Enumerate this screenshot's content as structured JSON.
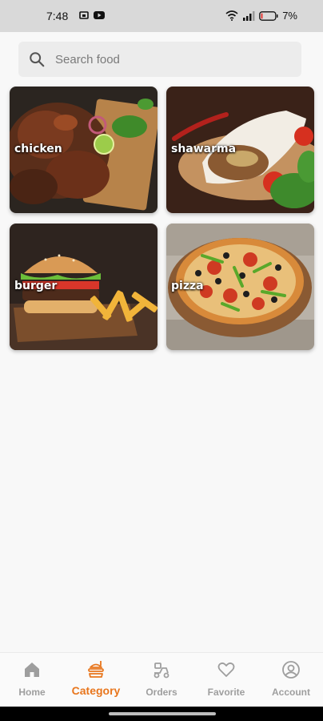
{
  "status_bar": {
    "time": "7:48",
    "battery": "7%"
  },
  "search": {
    "placeholder": "Search food",
    "value": ""
  },
  "categories": [
    {
      "label": "chicken"
    },
    {
      "label": "shawarma"
    },
    {
      "label": "burger"
    },
    {
      "label": "pizza"
    }
  ],
  "nav": {
    "active_color": "#e8761d",
    "items": [
      {
        "label": "Home",
        "icon": "home-icon"
      },
      {
        "label": "Category",
        "icon": "category-icon"
      },
      {
        "label": "Orders",
        "icon": "orders-icon"
      },
      {
        "label": "Favorite",
        "icon": "heart-icon"
      },
      {
        "label": "Account",
        "icon": "account-icon"
      }
    ]
  }
}
